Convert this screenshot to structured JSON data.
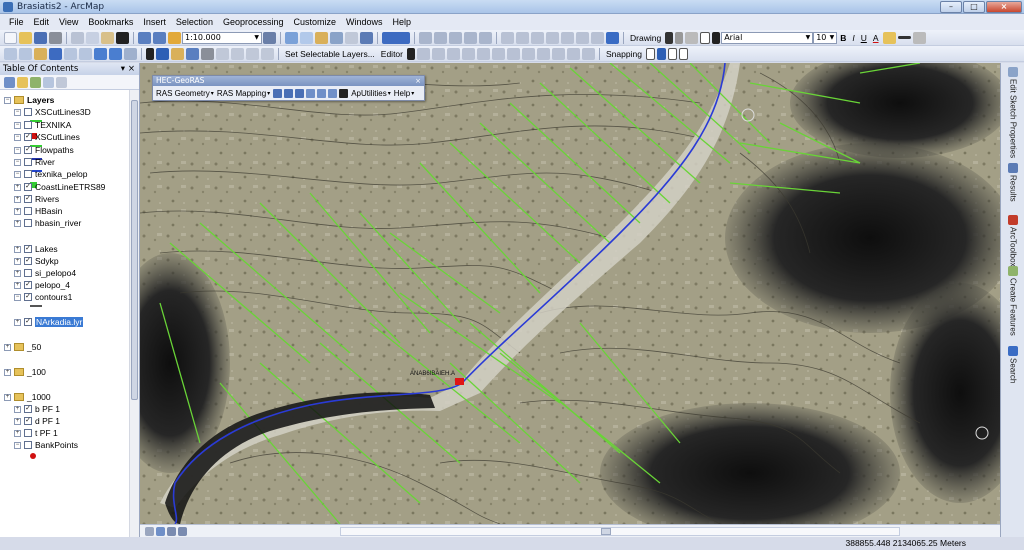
{
  "window": {
    "title": "Brasiatis2 - ArcMap"
  },
  "menu": [
    "File",
    "Edit",
    "View",
    "Bookmarks",
    "Insert",
    "Selection",
    "Geoprocessing",
    "Customize",
    "Windows",
    "Help"
  ],
  "toolbar1": {
    "scale": "1:10.000",
    "drawing_label": "Drawing",
    "font_name": "Arial",
    "font_size": "10",
    "bold": "B",
    "italic": "I",
    "underline": "U",
    "font_color": "A"
  },
  "toolbar2": {
    "set_selectable": "Set Selectable Layers...",
    "editor": "Editor",
    "snapping": "Snapping"
  },
  "toc": {
    "title": "Table Of Contents",
    "rows": [
      {
        "label": "Layers",
        "kind": "group",
        "checked": false
      },
      {
        "label": "XSCutLines3D",
        "kind": "layer",
        "checked": false,
        "sym": "line",
        "color": "#33cc33"
      },
      {
        "label": "TEXNIKA",
        "kind": "layer",
        "checked": false,
        "sym": "rect",
        "color": "#d01010"
      },
      {
        "label": "XSCutLines",
        "kind": "layer",
        "checked": true,
        "sym": "line",
        "color": "#33cc33"
      },
      {
        "label": "Flowpaths",
        "kind": "layer",
        "checked": true,
        "sym": "line",
        "color": "#2233aa"
      },
      {
        "label": "River",
        "kind": "layer",
        "checked": false,
        "sym": "line",
        "color": "#2244cc"
      },
      {
        "label": "texnika_pelop",
        "kind": "layer",
        "checked": false,
        "sym": "rect",
        "color": "#33cc33"
      },
      {
        "label": "CoastLineETRS89",
        "kind": "layer",
        "checked": true
      },
      {
        "label": "Rivers",
        "kind": "layer",
        "checked": true
      },
      {
        "label": "HBasin",
        "kind": "layer",
        "checked": false
      },
      {
        "label": "hbasin_river",
        "kind": "layer",
        "checked": false
      },
      {
        "label": "Lakes",
        "kind": "layer",
        "checked": true
      },
      {
        "label": "Sdykp",
        "kind": "layer",
        "checked": true
      },
      {
        "label": "si_pelopo4",
        "kind": "layer",
        "checked": false
      },
      {
        "label": "pelopo_4",
        "kind": "layer",
        "checked": true
      },
      {
        "label": "contours1",
        "kind": "layer",
        "checked": true,
        "sym": "line",
        "color": "#555555"
      },
      {
        "label": "NArkadia.lyr",
        "kind": "layer",
        "checked": true,
        "selected": true
      },
      {
        "label": "_50",
        "kind": "group",
        "checked": false
      },
      {
        "label": "_100",
        "kind": "group",
        "checked": false
      },
      {
        "label": "_1000",
        "kind": "group",
        "checked": false
      },
      {
        "label": "b PF 1",
        "kind": "layer",
        "checked": true
      },
      {
        "label": "d PF 1",
        "kind": "layer",
        "checked": true
      },
      {
        "label": "t PF 1",
        "kind": "layer",
        "checked": false
      },
      {
        "label": "BankPoints",
        "kind": "layer",
        "checked": false,
        "sym": "dot",
        "color": "#d01010"
      }
    ]
  },
  "hecgeoras": {
    "title": "HEC-GeoRAS",
    "ras_geometry": "RAS Geometry",
    "ras_mapping": "RAS Mapping",
    "aputilities": "ApUtilities",
    "help": "Help"
  },
  "map": {
    "label": "ANAB6IBAIEH.A",
    "colors": {
      "river": "#2a3bd6",
      "xs": "#69d437",
      "terrain": "#9b9680"
    }
  },
  "right_dock": [
    "Edit Sketch Properties",
    "Results",
    "ArcToolbox",
    "Create Features",
    "Search"
  ],
  "status": {
    "coords": "388855.448  2134065.25 Meters"
  }
}
